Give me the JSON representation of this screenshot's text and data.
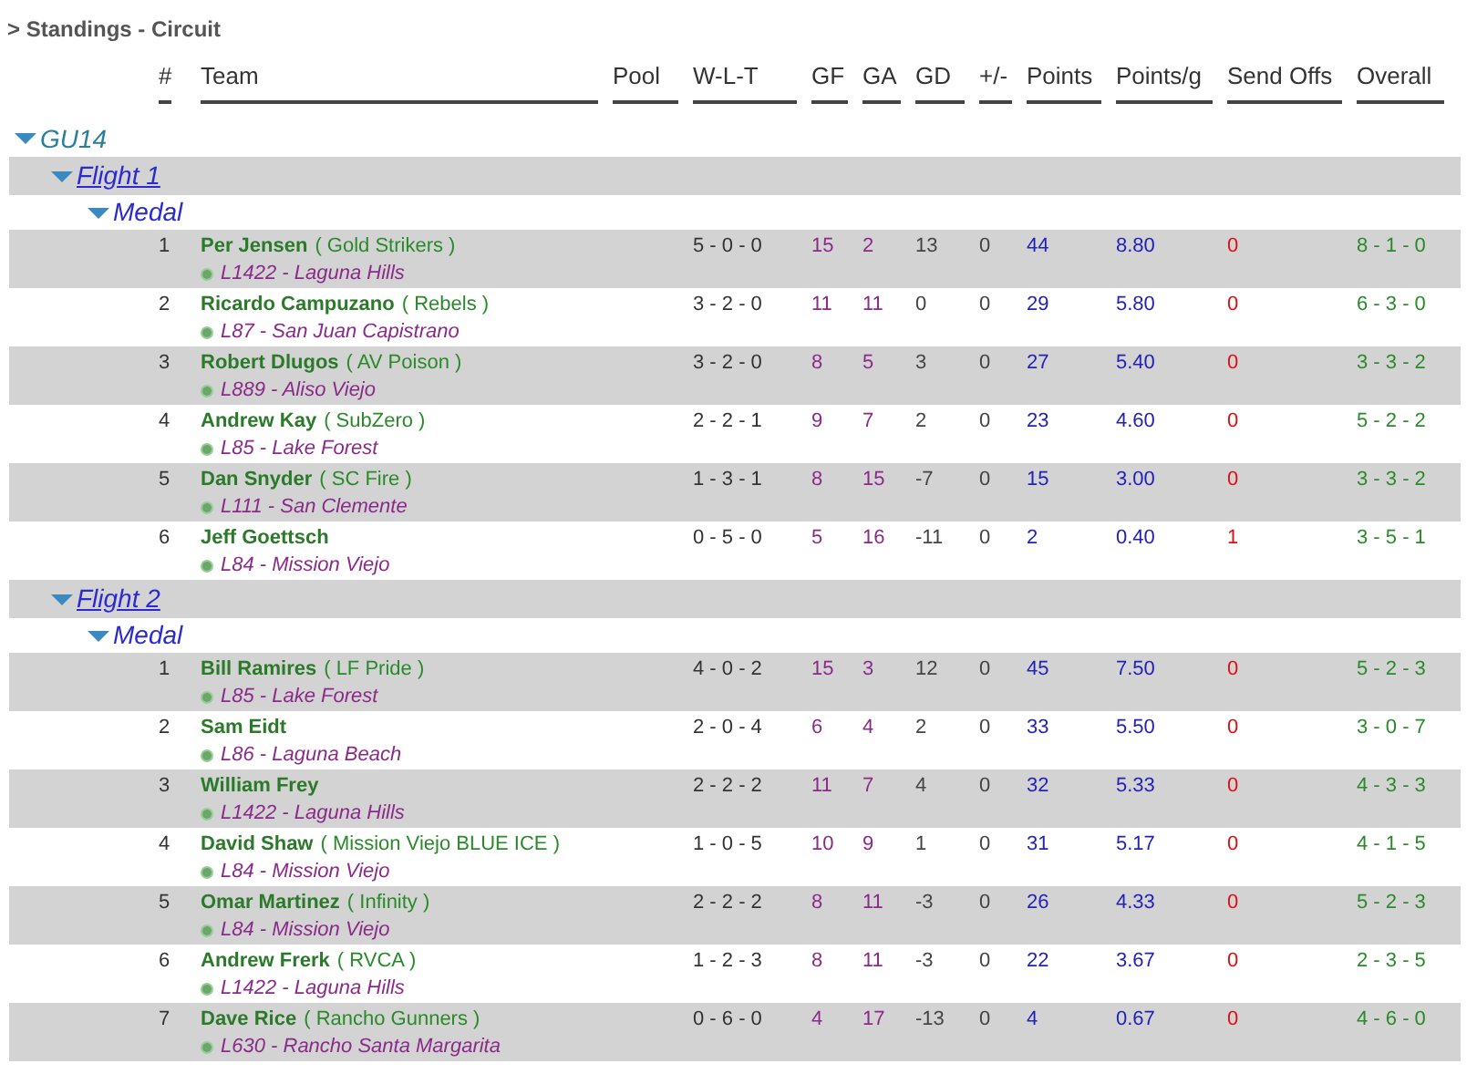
{
  "title": "> Standings - Circuit",
  "columns": [
    "#",
    "Team",
    "Pool",
    "W-L-T",
    "GF",
    "GA",
    "GD",
    "+/-",
    "Points",
    "Points/g",
    "Send Offs",
    "Overall"
  ],
  "groups": [
    {
      "label": "GU14",
      "expanded": true,
      "flights": [
        {
          "label": "Flight 1",
          "expanded": true,
          "pools": [
            {
              "label": "Medal",
              "expanded": true,
              "rows": [
                {
                  "rank": "1",
                  "player": "Per Jensen",
                  "team": "( Gold Strikers )",
                  "location": "L1422 - Laguna Hills",
                  "wlt": "5 - 0 - 0",
                  "gf": "15",
                  "ga": "2",
                  "gd": "13",
                  "plus_minus": "0",
                  "points": "44",
                  "points_per_game": "8.80",
                  "send_offs": "0",
                  "overall": "8 - 1 - 0"
                },
                {
                  "rank": "2",
                  "player": "Ricardo Campuzano",
                  "team": "( Rebels )",
                  "location": "L87 - San Juan Capistrano",
                  "wlt": "3 - 2 - 0",
                  "gf": "11",
                  "ga": "11",
                  "gd": "0",
                  "plus_minus": "0",
                  "points": "29",
                  "points_per_game": "5.80",
                  "send_offs": "0",
                  "overall": "6 - 3 - 0"
                },
                {
                  "rank": "3",
                  "player": "Robert Dlugos",
                  "team": "( AV Poison )",
                  "location": "L889 - Aliso Viejo",
                  "wlt": "3 - 2 - 0",
                  "gf": "8",
                  "ga": "5",
                  "gd": "3",
                  "plus_minus": "0",
                  "points": "27",
                  "points_per_game": "5.40",
                  "send_offs": "0",
                  "overall": "3 - 3 - 2"
                },
                {
                  "rank": "4",
                  "player": "Andrew Kay",
                  "team": "( SubZero )",
                  "location": "L85 - Lake Forest",
                  "wlt": "2 - 2 - 1",
                  "gf": "9",
                  "ga": "7",
                  "gd": "2",
                  "plus_minus": "0",
                  "points": "23",
                  "points_per_game": "4.60",
                  "send_offs": "0",
                  "overall": "5 - 2 - 2"
                },
                {
                  "rank": "5",
                  "player": "Dan Snyder",
                  "team": "( SC Fire )",
                  "location": "L111 - San Clemente",
                  "wlt": "1 - 3 - 1",
                  "gf": "8",
                  "ga": "15",
                  "gd": "-7",
                  "plus_minus": "0",
                  "points": "15",
                  "points_per_game": "3.00",
                  "send_offs": "0",
                  "overall": "3 - 3 - 2"
                },
                {
                  "rank": "6",
                  "player": "Jeff Goettsch",
                  "location": "L84 - Mission Viejo",
                  "wlt": "0 - 5 - 0",
                  "gf": "5",
                  "ga": "16",
                  "gd": "-11",
                  "plus_minus": "0",
                  "points": "2",
                  "points_per_game": "0.40",
                  "send_offs": "1",
                  "overall": "3 - 5 - 1"
                }
              ]
            }
          ]
        },
        {
          "label": "Flight 2",
          "expanded": true,
          "pools": [
            {
              "label": "Medal",
              "expanded": true,
              "rows": [
                {
                  "rank": "1",
                  "player": "Bill Ramires",
                  "team": "( LF Pride )",
                  "location": "L85 - Lake Forest",
                  "wlt": "4 - 0 - 2",
                  "gf": "15",
                  "ga": "3",
                  "gd": "12",
                  "plus_minus": "0",
                  "points": "45",
                  "points_per_game": "7.50",
                  "send_offs": "0",
                  "overall": "5 - 2 - 3"
                },
                {
                  "rank": "2",
                  "player": "Sam Eidt",
                  "location": "L86 - Laguna Beach",
                  "wlt": "2 - 0 - 4",
                  "gf": "6",
                  "ga": "4",
                  "gd": "2",
                  "plus_minus": "0",
                  "points": "33",
                  "points_per_game": "5.50",
                  "send_offs": "0",
                  "overall": "3 - 0 - 7"
                },
                {
                  "rank": "3",
                  "player": "William Frey",
                  "location": "L1422 - Laguna Hills",
                  "wlt": "2 - 2 - 2",
                  "gf": "11",
                  "ga": "7",
                  "gd": "4",
                  "plus_minus": "0",
                  "points": "32",
                  "points_per_game": "5.33",
                  "send_offs": "0",
                  "overall": "4 - 3 - 3"
                },
                {
                  "rank": "4",
                  "player": "David Shaw",
                  "team": "( Mission Viejo BLUE ICE )",
                  "location": "L84 - Mission Viejo",
                  "wlt": "1 - 0 - 5",
                  "gf": "10",
                  "ga": "9",
                  "gd": "1",
                  "plus_minus": "0",
                  "points": "31",
                  "points_per_game": "5.17",
                  "send_offs": "0",
                  "overall": "4 - 1 - 5"
                },
                {
                  "rank": "5",
                  "player": "Omar Martinez",
                  "team": "( Infinity )",
                  "location": "L84 - Mission Viejo",
                  "wlt": "2 - 2 - 2",
                  "gf": "8",
                  "ga": "11",
                  "gd": "-3",
                  "plus_minus": "0",
                  "points": "26",
                  "points_per_game": "4.33",
                  "send_offs": "0",
                  "overall": "5 - 2 - 3"
                },
                {
                  "rank": "6",
                  "player": "Andrew Frerk",
                  "team": "( RVCA )",
                  "location": "L1422 - Laguna Hills",
                  "wlt": "1 - 2 - 3",
                  "gf": "8",
                  "ga": "11",
                  "gd": "-3",
                  "plus_minus": "0",
                  "points": "22",
                  "points_per_game": "3.67",
                  "send_offs": "0",
                  "overall": "2 - 3 - 5"
                },
                {
                  "rank": "7",
                  "player": "Dave Rice",
                  "team": "( Rancho Gunners )",
                  "location": "L630 - Rancho Santa Margarita",
                  "wlt": "0 - 6 - 0",
                  "gf": "4",
                  "ga": "17",
                  "gd": "-13",
                  "plus_minus": "0",
                  "points": "4",
                  "points_per_game": "0.67",
                  "send_offs": "0",
                  "overall": "4 - 6 - 0"
                }
              ]
            }
          ]
        }
      ]
    }
  ]
}
